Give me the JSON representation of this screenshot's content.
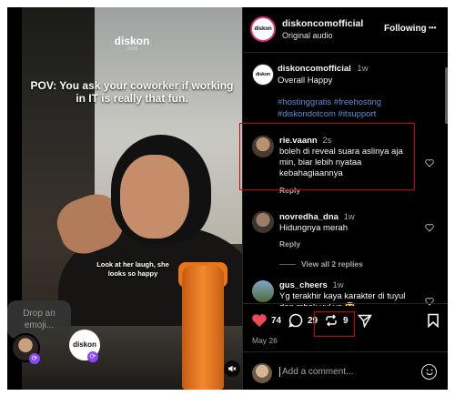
{
  "media": {
    "logo": "diskon",
    "logo_sub": ".com",
    "caption": "POV: You ask your coworker if working in IT is really that fun.",
    "subtitle": "Look at her laugh, she looks so happy",
    "mute_icon": "speaker-muted-icon"
  },
  "emoji_picker": {
    "placeholder": "Drop an emoji..."
  },
  "header": {
    "username": "diskoncomofficial",
    "audio": "Original audio",
    "follow_label": "Following",
    "more_label": "•••"
  },
  "caption_post": {
    "username": "diskoncomofficial",
    "time": "1w",
    "text": "Overall Happy",
    "hashtags_line1": "#hostinggratis #freehosting",
    "hashtags_line2": "#diskondotcom #itsupport"
  },
  "comments": [
    {
      "username": "rie.vaann",
      "time": "2s",
      "text": "boleh di reveal suara aslinya aja min, biar lebih nyataa kebahagiaannya",
      "reply": "Reply"
    },
    {
      "username": "novredha_dna",
      "time": "1w",
      "text": "Hidungnya merah",
      "reply": "Reply",
      "view_replies": "View all 2 replies"
    },
    {
      "username": "gus_cheers",
      "time": "1w",
      "text": "Yg terakhir kaya karakter di tuyul dan mbak yul ya 😂"
    }
  ],
  "actions": {
    "likes": "74",
    "comments": "29",
    "reposts": "9",
    "date": "May 26"
  },
  "composer": {
    "placeholder": "Add a comment..."
  },
  "colors": {
    "like_red": "#ed4956",
    "highlight": "#cc0000",
    "hashtag_blue": "#5b8dd6"
  }
}
